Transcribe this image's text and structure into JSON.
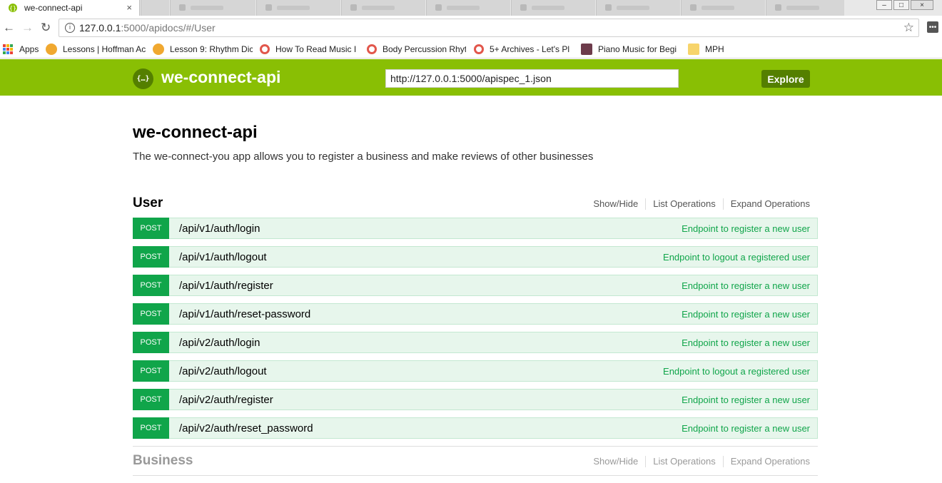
{
  "browser": {
    "active_tab": {
      "title": "we-connect-api",
      "close": "×"
    },
    "nav": {
      "back": "←",
      "forward": "→",
      "reload": "↻"
    },
    "address": {
      "host": "127.0.0.1",
      "rest": ":5000/apidocs/#/User",
      "info": "i",
      "star": "☆"
    },
    "menu": "•••",
    "window_controls": [
      "–",
      "□",
      "×"
    ],
    "bookmarks": [
      {
        "label": "Apps",
        "icon": "apps-grid-icon"
      },
      {
        "label": "Lessons | Hoffman Ac",
        "icon": "hoffman-icon"
      },
      {
        "label": "Lesson 9: Rhythm Dic",
        "icon": "hoffman-icon"
      },
      {
        "label": "How To Read Music I",
        "icon": "ring-icon"
      },
      {
        "label": "Body Percussion Rhyt",
        "icon": "ring-icon"
      },
      {
        "label": "5+ Archives - Let's Pl",
        "icon": "ring-icon"
      },
      {
        "label": "Piano Music for Begi",
        "icon": "piano-icon"
      },
      {
        "label": "MPH",
        "icon": "folder-icon"
      }
    ]
  },
  "header": {
    "logo_glyph": "{…}",
    "logo_text": "we-connect-api",
    "spec_url": "http://127.0.0.1:5000/apispec_1.json",
    "explore_label": "Explore",
    "colors": {
      "bar": "#89bf04",
      "button": "#547f00"
    }
  },
  "info": {
    "title": "we-connect-api",
    "description": "The we-connect-you app allows you to register a business and make reviews of other businesses"
  },
  "resources": [
    {
      "name": "User",
      "links": [
        "Show/Hide",
        "List Operations",
        "Expand Operations"
      ],
      "operations": [
        {
          "method": "POST",
          "path": "/api/v1/auth/login",
          "summary": "Endpoint to register a new user"
        },
        {
          "method": "POST",
          "path": "/api/v1/auth/logout",
          "summary": "Endpoint to logout a registered user"
        },
        {
          "method": "POST",
          "path": "/api/v1/auth/register",
          "summary": "Endpoint to register a new user"
        },
        {
          "method": "POST",
          "path": "/api/v1/auth/reset-password",
          "summary": "Endpoint to register a new user"
        },
        {
          "method": "POST",
          "path": "/api/v2/auth/login",
          "summary": "Endpoint to register a new user"
        },
        {
          "method": "POST",
          "path": "/api/v2/auth/logout",
          "summary": "Endpoint to logout a registered user"
        },
        {
          "method": "POST",
          "path": "/api/v2/auth/register",
          "summary": "Endpoint to register a new user"
        },
        {
          "method": "POST",
          "path": "/api/v2/auth/reset_password",
          "summary": "Endpoint to register a new user"
        }
      ]
    },
    {
      "name": "Business",
      "links": [
        "Show/Hide",
        "List Operations",
        "Expand Operations"
      ]
    }
  ],
  "colors": {
    "post_method": "#10a54a",
    "post_row_bg": "#e7f6ec"
  }
}
